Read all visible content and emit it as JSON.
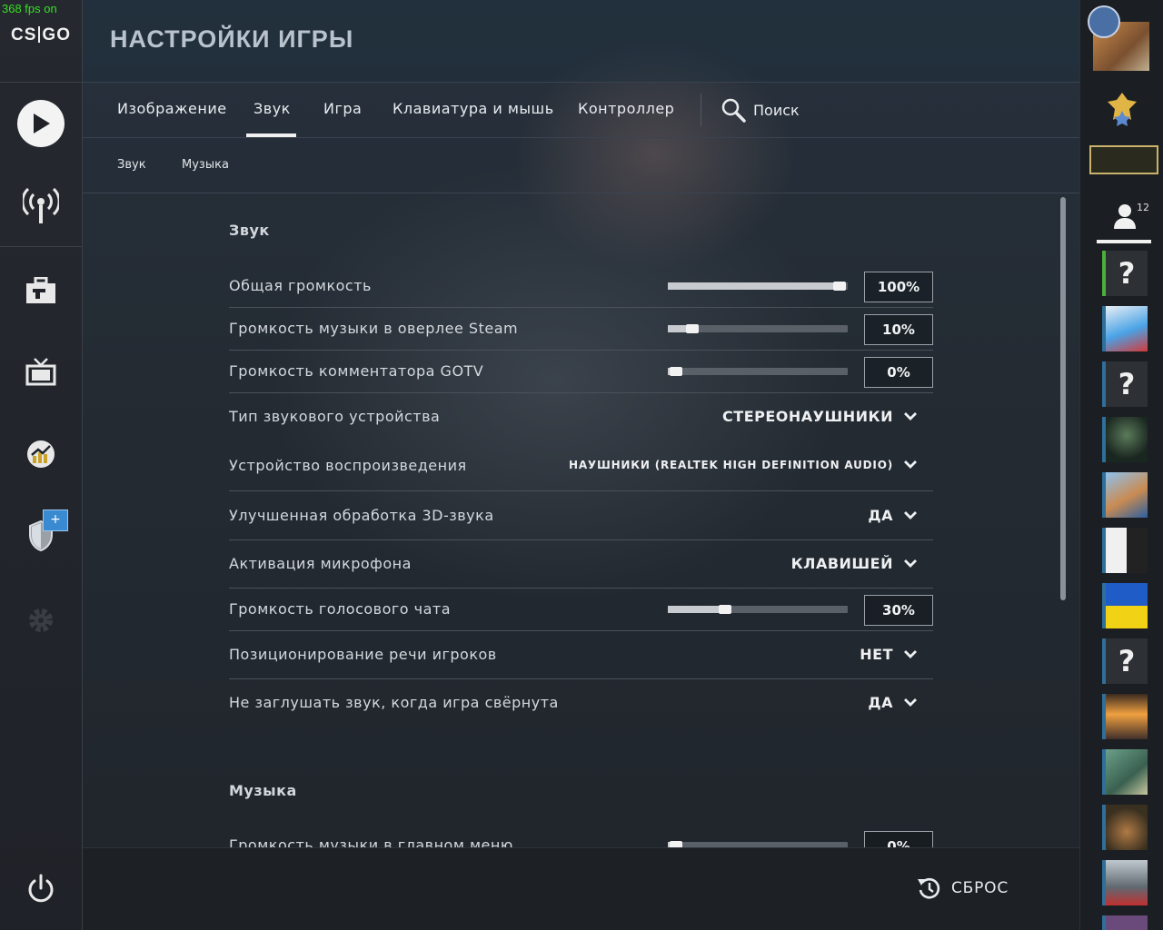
{
  "overlay": {
    "fps": "368 fps on"
  },
  "brand": {
    "logo_left": "CS",
    "logo_right": "GO"
  },
  "header": {
    "title": "НАСТРОЙКИ ИГРЫ"
  },
  "tabs": [
    {
      "label": "Изображение"
    },
    {
      "label": "Звук"
    },
    {
      "label": "Игра"
    },
    {
      "label": "Клавиатура и мышь"
    },
    {
      "label": "Контроллер"
    }
  ],
  "active_tab": "Звук",
  "search": {
    "label": "Поиск"
  },
  "subtabs": [
    {
      "label": "Звук"
    },
    {
      "label": "Музыка"
    }
  ],
  "sections": {
    "sound": {
      "title": "Звук"
    },
    "music": {
      "title": "Музыка"
    }
  },
  "settings": {
    "master_volume": {
      "label": "Общая громкость",
      "value": "100%",
      "level": 1.0
    },
    "steam_music_volume": {
      "label": "Громкость музыки в оверлее Steam",
      "value": "10%",
      "level": 0.1
    },
    "gotv_volume": {
      "label": "Громкость комментатора GOTV",
      "value": "0%",
      "level": 0.0
    },
    "device_type": {
      "label": "Тип звукового устройства",
      "value": "СТЕРЕОНАУШНИКИ"
    },
    "playback_device": {
      "label": "Устройство воспроизведения",
      "value": "НАУШНИКИ (REALTEK HIGH DEFINITION AUDIO)"
    },
    "enhanced_3d": {
      "label": "Улучшенная обработка 3D-звука",
      "value": "ДА"
    },
    "mic_activation": {
      "label": "Активация микрофона",
      "value": "КЛАВИШЕЙ"
    },
    "voice_volume": {
      "label": "Громкость голосового чата",
      "value": "30%",
      "level": 0.3
    },
    "voice_positioning": {
      "label": "Позиционирование речи игроков",
      "value": "НЕТ"
    },
    "play_when_minimized": {
      "label": "Не заглушать звук, когда игра свёрнута",
      "value": "ДА"
    },
    "menu_music_volume": {
      "label": "Громкость музыки в главном меню",
      "value": "0%",
      "level": 0.0
    }
  },
  "footer": {
    "reset_label": "СБРОС"
  },
  "friends": {
    "count": "12"
  },
  "colors": {
    "accent_green": "#35e020",
    "online_strip": "#4caf3a",
    "offline_strip": "#2f6f9a",
    "badge_blue": "#3a8ad2"
  }
}
